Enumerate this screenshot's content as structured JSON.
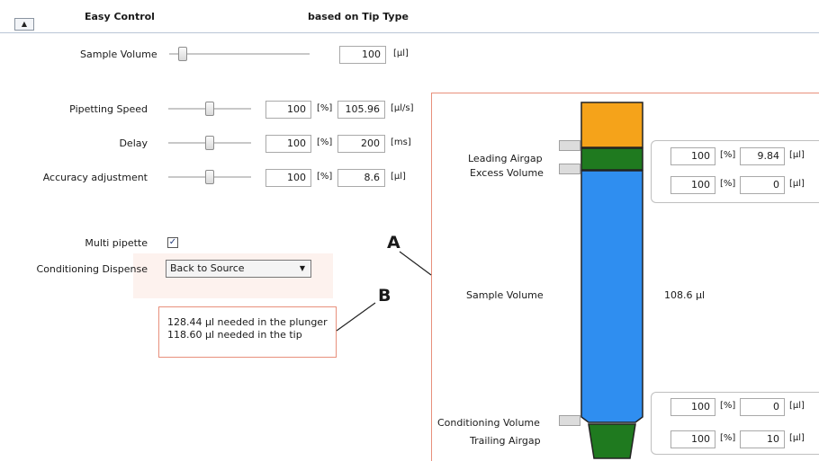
{
  "header": {
    "collapse_glyph": "▲",
    "easy_control": "Easy Control",
    "based_on": "based on Tip Type"
  },
  "sample_volume": {
    "label": "Sample Volume",
    "value": "100",
    "unit": "[µl]",
    "slider_level": 0.12
  },
  "pipetting_speed": {
    "label": "Pipetting Speed",
    "percent": "100",
    "percent_unit": "[%]",
    "value": "105.96",
    "unit": "[µl/s]",
    "slider_level": 0.5
  },
  "delay": {
    "label": "Delay",
    "percent": "100",
    "percent_unit": "[%]",
    "value": "200",
    "unit": "[ms]",
    "slider_level": 0.5
  },
  "accuracy": {
    "label": "Accuracy adjustment",
    "percent": "100",
    "percent_unit": "[%]",
    "value": "8.6",
    "unit": "[µl]",
    "slider_level": 0.5
  },
  "multi_pipette": {
    "label": "Multi pipette",
    "checked": true,
    "check_glyph": "✓"
  },
  "conditioning_dispense": {
    "label": "Conditioning Dispense",
    "selected": "Back to Source",
    "arrow": "▼"
  },
  "plunger_info": {
    "line1": "128.44 µl needed in the plunger",
    "line2": "118.60 µl needed in the tip"
  },
  "callouts": {
    "a": "A",
    "b": "B"
  },
  "tip": {
    "leading_airgap": {
      "label": "Leading Airgap",
      "percent": "100",
      "percent_unit": "[%]",
      "value": "9.84",
      "unit": "[µl]"
    },
    "excess_volume": {
      "label": "Excess Volume",
      "percent": "100",
      "percent_unit": "[%]",
      "value": "0",
      "unit": "[µl]"
    },
    "sample_volume": {
      "label": "Sample Volume",
      "value": "108.6 µl"
    },
    "conditioning_volume": {
      "label": "Conditioning Volume",
      "percent": "100",
      "percent_unit": "[%]",
      "value": "0",
      "unit": "[µl]"
    },
    "trailing_airgap": {
      "label": "Trailing Airgap",
      "percent": "100",
      "percent_unit": "[%]",
      "value": "10",
      "unit": "[µl]"
    }
  },
  "colors": {
    "orange": "#f5a31a",
    "green": "#1f7a1f",
    "blue": "#2f8ef0",
    "outline": "#e8907c"
  }
}
